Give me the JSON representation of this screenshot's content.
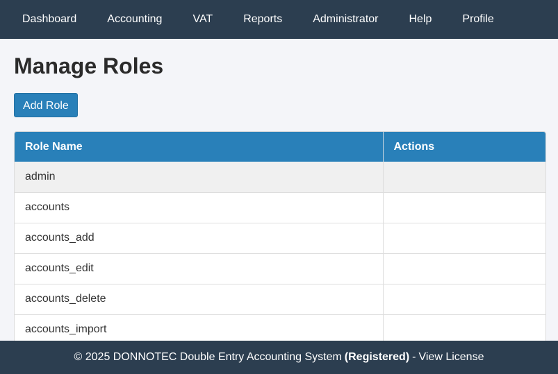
{
  "nav": {
    "items": [
      {
        "label": "Dashboard"
      },
      {
        "label": "Accounting"
      },
      {
        "label": "VAT"
      },
      {
        "label": "Reports"
      },
      {
        "label": "Administrator"
      },
      {
        "label": "Help"
      },
      {
        "label": "Profile"
      }
    ]
  },
  "page": {
    "title": "Manage Roles",
    "add_button_label": "Add Role"
  },
  "table": {
    "columns": [
      "Role Name",
      "Actions"
    ],
    "rows": [
      {
        "name": "admin",
        "actions": ""
      },
      {
        "name": "accounts",
        "actions": ""
      },
      {
        "name": "accounts_add",
        "actions": ""
      },
      {
        "name": "accounts_edit",
        "actions": ""
      },
      {
        "name": "accounts_delete",
        "actions": ""
      },
      {
        "name": "accounts_import",
        "actions": ""
      }
    ]
  },
  "footer": {
    "copyright": "© 2025 DONNOTEC Double Entry Accounting System",
    "status": "(Registered)",
    "separator": "-",
    "license_link": "View License"
  }
}
